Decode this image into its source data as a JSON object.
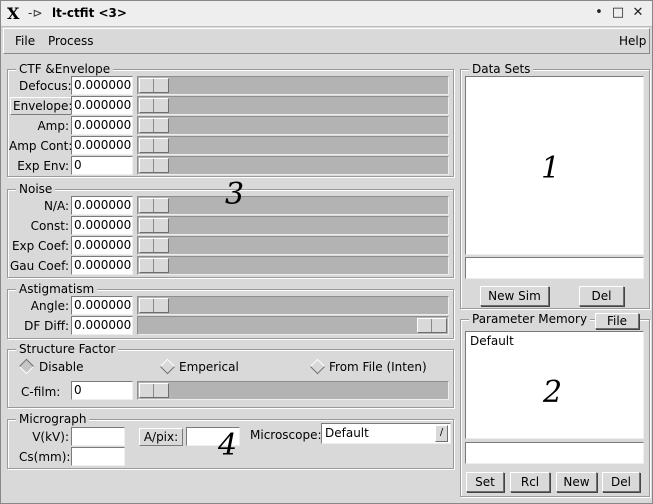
{
  "window": {
    "title": "lt-ctfit <3>",
    "app_icon": "X",
    "pin_icon": "-⊳",
    "controls": [
      "•",
      "□",
      "✕"
    ]
  },
  "menubar": {
    "file": "File",
    "process": "Process",
    "help": "Help"
  },
  "ctf": {
    "title": "CTF &Envelope",
    "rows": [
      {
        "label": "Defocus:",
        "value": "0.000000"
      },
      {
        "label": "Envelope:",
        "value": "0.000000"
      },
      {
        "label": "Amp:",
        "value": "0.000000"
      },
      {
        "label": "Amp Cont:",
        "value": "0.000000"
      },
      {
        "label": "Exp Env:",
        "value": "0"
      }
    ]
  },
  "noise": {
    "title": "Noise",
    "rows": [
      {
        "label": "N/A:",
        "value": "0.000000"
      },
      {
        "label": "Const:",
        "value": "0.000000"
      },
      {
        "label": "Exp Coef:",
        "value": "0.000000"
      },
      {
        "label": "Gau Coef:",
        "value": "0.000000"
      }
    ]
  },
  "astig": {
    "title": "Astigmatism",
    "rows": [
      {
        "label": "Angle:",
        "value": "0.000000"
      },
      {
        "label": "DF Diff:",
        "value": "0.000000"
      }
    ]
  },
  "structure": {
    "title": "Structure Factor",
    "options": [
      "Disable",
      "Emperical",
      "From File (Inten)"
    ],
    "cfilm_label": "C-film:",
    "cfilm_value": "0"
  },
  "micrograph": {
    "title": "Micrograph",
    "kv_label": "V(kV):",
    "cs_label": "Cs(mm):",
    "apix_label": "A/pix:",
    "microscope_label": "Microscope:",
    "microscope_value": "Default"
  },
  "datasets": {
    "title": "Data Sets",
    "new_sim": "New Sim",
    "del": "Del"
  },
  "memory": {
    "title": "Parameter Memory",
    "file_btn": "File",
    "items": [
      "Default"
    ],
    "set": "Set",
    "rcl": "Rcl",
    "new": "New",
    "del": "Del"
  },
  "annotations": {
    "a1": "1",
    "a2": "2",
    "a3": "3",
    "a4": "4"
  }
}
